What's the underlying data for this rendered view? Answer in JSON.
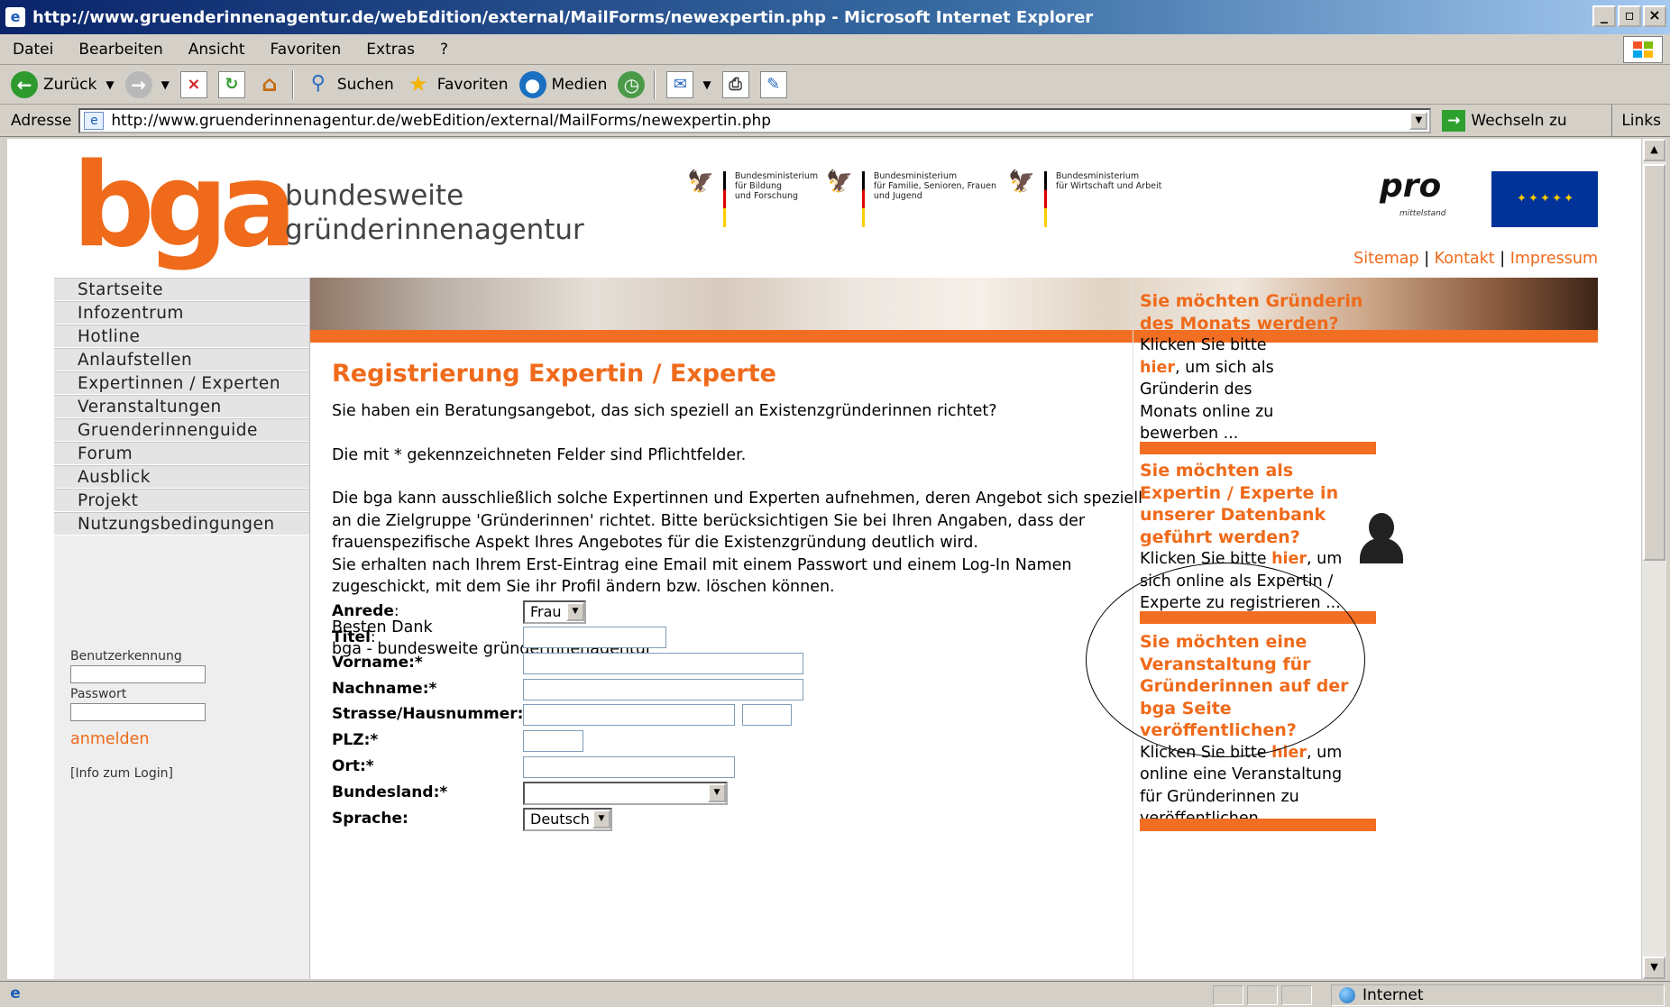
{
  "window": {
    "title": "http://www.gruenderinnenagentur.de/webEdition/external/MailForms/newexpertin.php - Microsoft Internet Explorer",
    "controls": [
      "_",
      "▫",
      "×"
    ]
  },
  "menubar": [
    "Datei",
    "Bearbeiten",
    "Ansicht",
    "Favoriten",
    "Extras",
    "?"
  ],
  "toolbar": {
    "back": "Zurück",
    "search": "Suchen",
    "favorites": "Favoriten",
    "media": "Medien"
  },
  "addressbar": {
    "label": "Adresse",
    "url": "http://www.gruenderinnenagentur.de/webEdition/external/MailForms/newexpertin.php",
    "go": "Wechseln zu",
    "links": "Links"
  },
  "header": {
    "logo": "bga",
    "logo_sub_1": "bundesweite",
    "logo_sub_2": "gründerinnenagentur",
    "ministries": [
      [
        "Bundesministerium",
        "für Bildung",
        "und Forschung"
      ],
      [
        "Bundesministerium",
        "für Familie, Senioren, Frauen",
        "und Jugend"
      ],
      [
        "Bundesministerium",
        "für Wirtschaft und Arbeit"
      ]
    ],
    "pro_logo": "pro",
    "pro_sub": "mittelstand",
    "toplinks": [
      "Sitemap",
      "Kontakt",
      "Impressum"
    ],
    "sep": "|"
  },
  "nav": [
    "Startseite",
    "Infozentrum",
    "Hotline",
    "Anlaufstellen",
    "Expertinnen / Experten",
    "Veranstaltungen",
    "Gruenderinnenguide",
    "Forum",
    "Ausblick",
    "Projekt",
    "Nutzungsbedingungen"
  ],
  "login": {
    "user_label": "Benutzerkennung",
    "pass_label": "Passwort",
    "submit": "anmelden",
    "info": "[Info zum Login]"
  },
  "main": {
    "title": "Registrierung Expertin / Experte",
    "p1": "Sie haben ein Beratungsangebot, das sich speziell an Existenzgründerinnen richtet?",
    "p2": "Die mit * gekennzeichneten Felder sind Pflichtfelder.",
    "p3a": "Die bga kann ausschließlich solche Expertinnen und Experten aufnehmen, deren Angebot sich speziell an die Zielgruppe 'Gründerinnen' richtet. Bitte berücksichtigen Sie bei Ihren Angaben, dass der frauenspezifische Aspekt Ihres Angebotes für die Existenzgründung deutlich wird.",
    "p3b": "Sie erhalten nach Ihrem Erst-Eintrag eine Email mit einem Passwort und einem Log-In Namen zugeschickt, mit dem Sie ihr Profil ändern bzw. löschen können.",
    "thanks": "Besten Dank",
    "signature": "bga - bundesweite gründerinnenagentur"
  },
  "form": {
    "anrede": "Anrede",
    "anrede_value": "Frau",
    "titel": "Titel",
    "vorname": "Vorname",
    "nachname": "Nachname",
    "strasse": "Strasse/Hausnummer",
    "plz": "PLZ",
    "ort": "Ort",
    "bundesland": "Bundesland",
    "sprache": "Sprache",
    "sprache_value": "Deutsch",
    "colon": ":",
    "req": ":*"
  },
  "sidebar": {
    "promo1_title": "Sie möchten Gründerin des Monats werden?",
    "promo1_pre": "Klicken Sie bitte ",
    "promo1_hier": "hier",
    "promo1_post": ", um sich als Gründerin des Monats online zu bewerben ...",
    "promo2_title": "Sie möchten als Expertin / Experte in unserer Datenbank geführt werden?",
    "promo2_pre": "Klicken Sie bitte ",
    "promo2_hier": "hier",
    "promo2_post": ", um sich online als Expertin / Experte zu registrieren ...",
    "promo3_title": "Sie möchten eine Veranstaltung für Gründerinnen auf der bga Seite veröffentlichen?",
    "promo3_pre": "Klicken Sie bitte ",
    "promo3_hier": "hier",
    "promo3_post": ", um online eine Veranstaltung für Gründerinnen zu veröffentlichen ..."
  },
  "statusbar": {
    "zone": "Internet"
  },
  "colors": {
    "accent": "#ef6a1a",
    "titlebar": "#0a246a"
  }
}
